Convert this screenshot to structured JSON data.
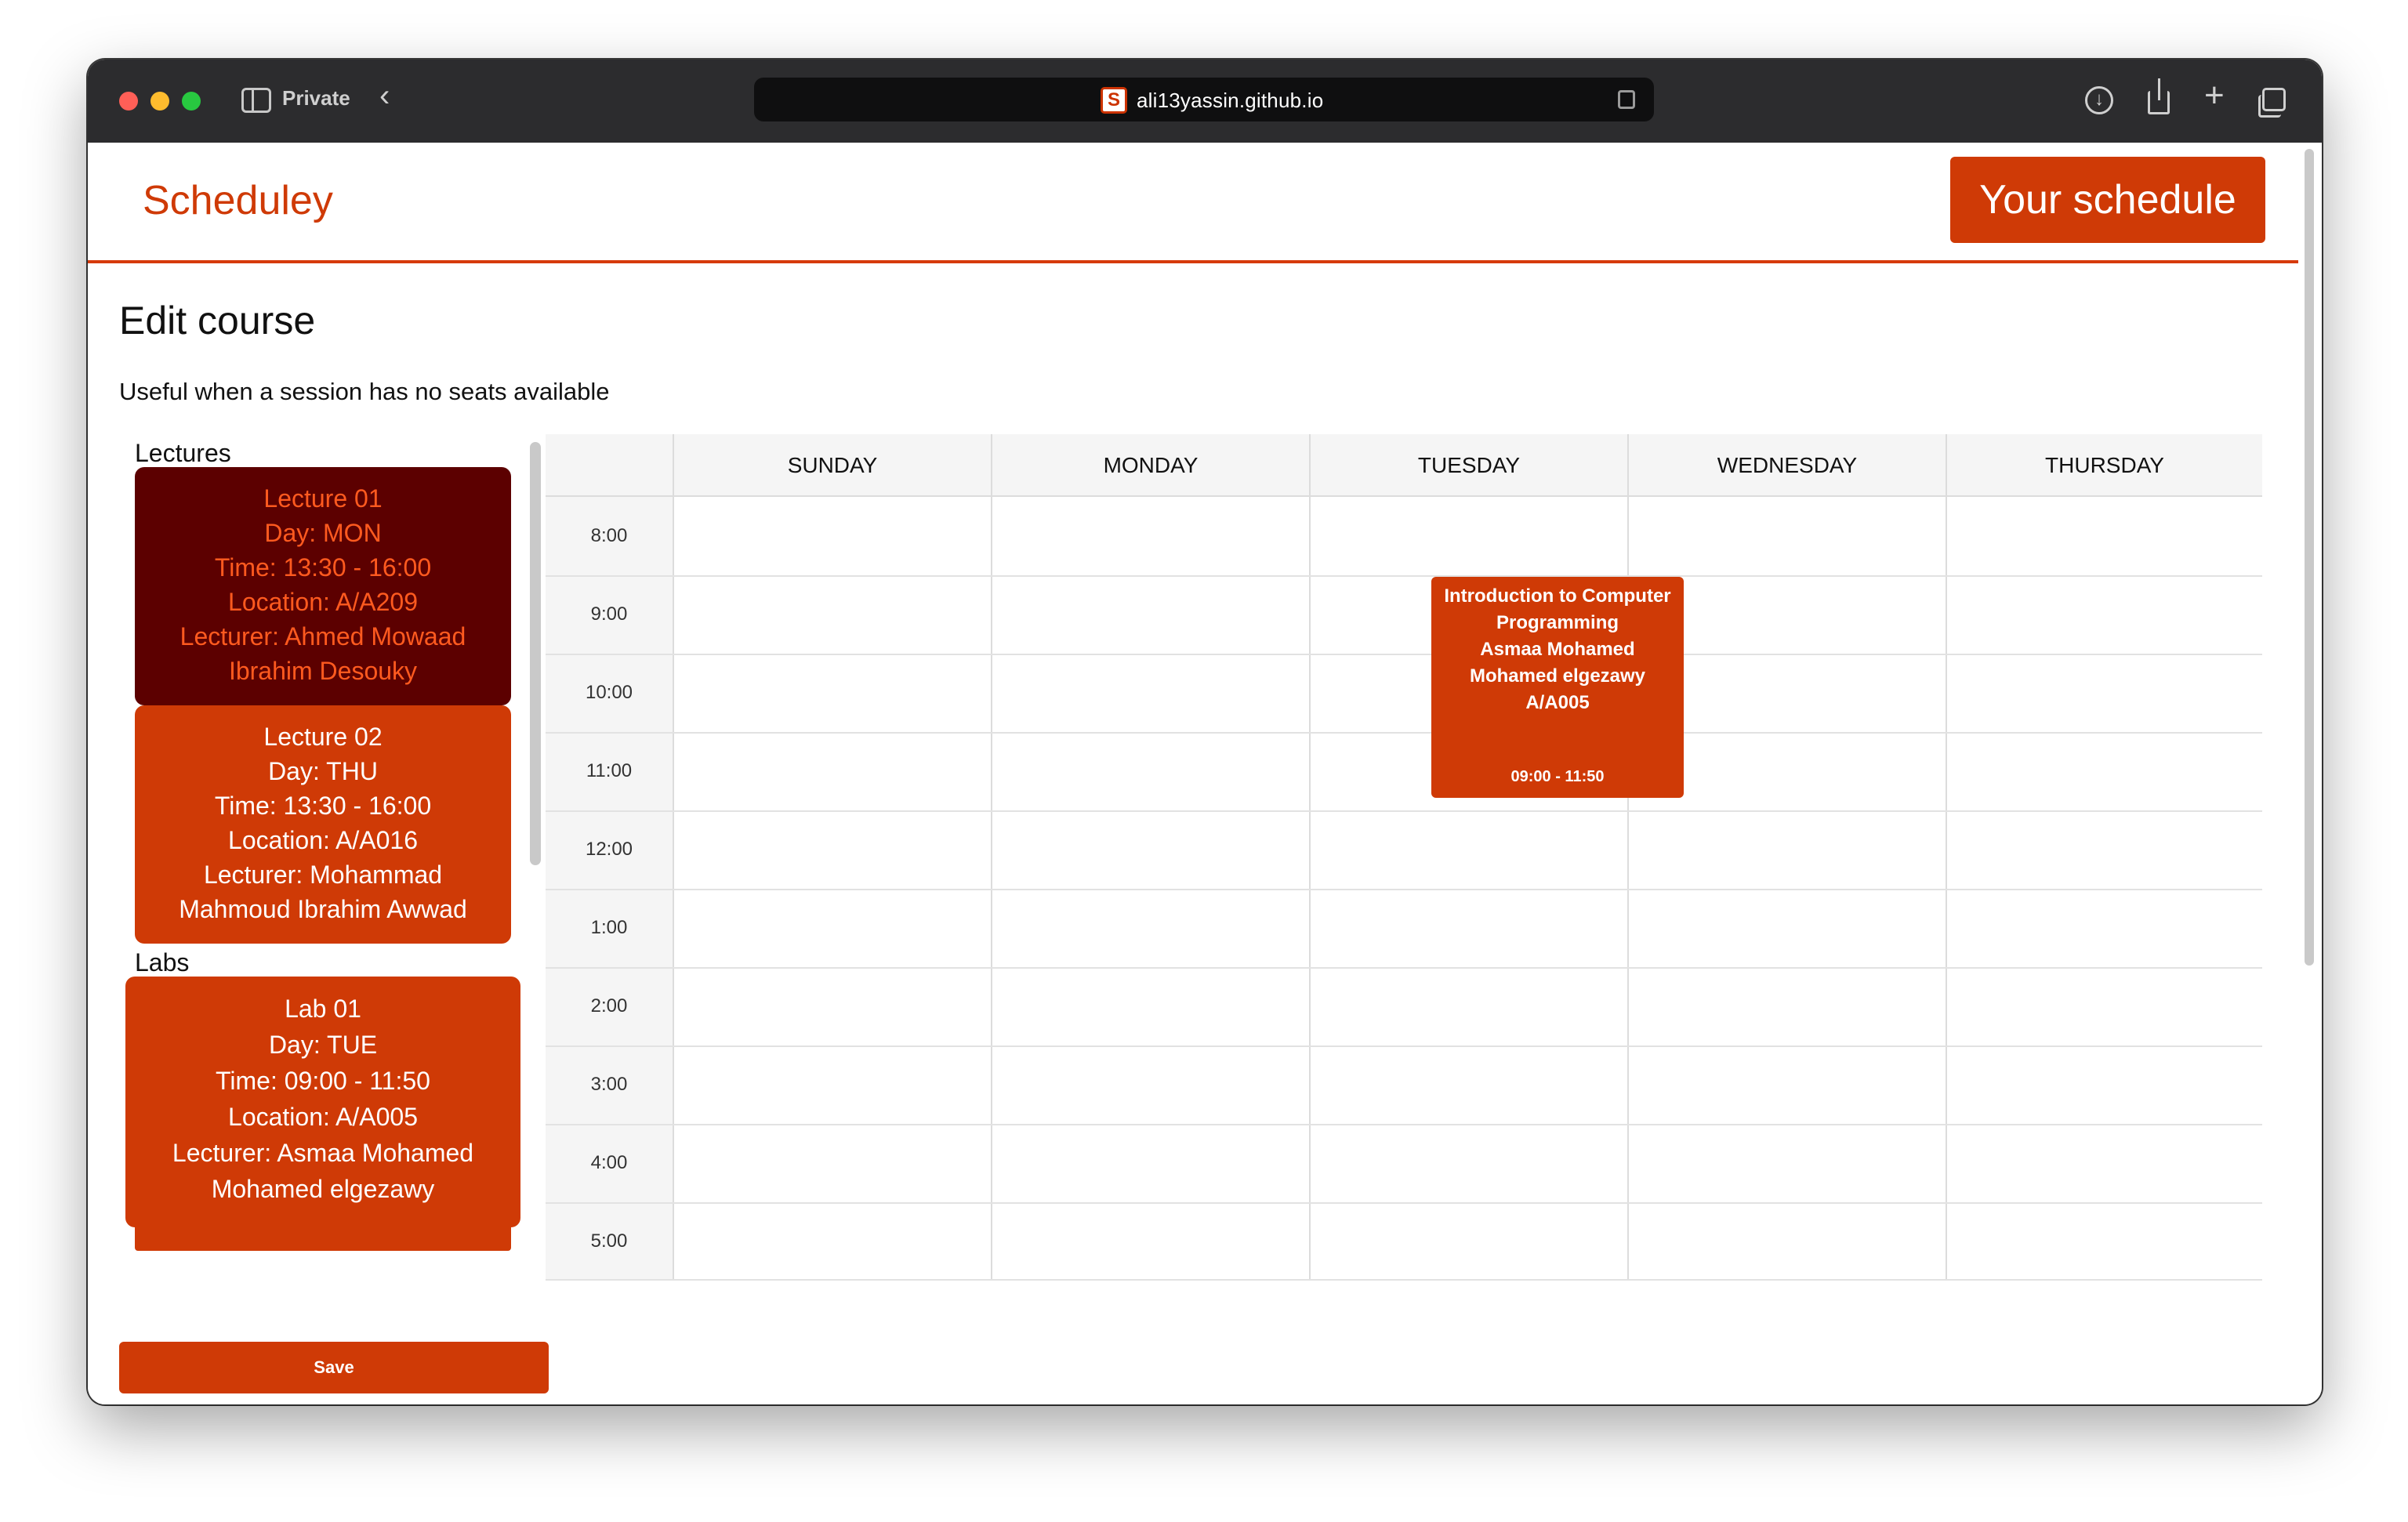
{
  "browser": {
    "mode_label": "Private",
    "url": "ali13yassin.github.io",
    "favicon_letter": "S"
  },
  "header": {
    "brand": "Scheduley",
    "your_schedule_label": "Your schedule"
  },
  "page": {
    "title": "Edit course",
    "subtitle": "Useful when a session has no seats available"
  },
  "sessions": {
    "lectures_label": "Lectures",
    "labs_label": "Labs",
    "lectures": [
      {
        "name": "Lecture 01",
        "day": "Day: MON",
        "time": "Time: 13:30 - 16:00",
        "location": "Location: A/A209",
        "lecturer_1": "Lecturer: Ahmed Mowaad",
        "lecturer_2": "Ibrahim Desouky",
        "selected": true
      },
      {
        "name": "Lecture 02",
        "day": "Day: THU",
        "time": "Time: 13:30 - 16:00",
        "location": "Location: A/A016",
        "lecturer_1": "Lecturer: Mohammad",
        "lecturer_2": "Mahmoud Ibrahim Awwad",
        "selected": false
      }
    ],
    "labs": [
      {
        "name": "Lab 01",
        "day": "Day: TUE",
        "time": "Time: 09:00 - 11:50",
        "location": "Location: A/A005",
        "lecturer_1": "Lecturer: Asmaa Mohamed",
        "lecturer_2": "Mohamed elgezawy",
        "selected": false
      }
    ],
    "save_label": "Save"
  },
  "timetable": {
    "days": [
      "SUNDAY",
      "MONDAY",
      "TUESDAY",
      "WEDNESDAY",
      "THURSDAY"
    ],
    "times": [
      "8:00",
      "9:00",
      "10:00",
      "11:00",
      "12:00",
      "1:00",
      "2:00",
      "3:00",
      "4:00",
      "5:00"
    ],
    "events": [
      {
        "day": "TUESDAY",
        "line_1": "Introduction to Computer",
        "line_2": "Programming",
        "line_3": "Asmaa Mohamed",
        "line_4": "Mohamed elgezawy",
        "line_5": "A/A005",
        "time": "09:00 - 11:50"
      }
    ]
  },
  "colors": {
    "accent": "#cf3a06",
    "selected_card_bg": "#5c0000",
    "selected_card_text": "#ff5a1f"
  }
}
